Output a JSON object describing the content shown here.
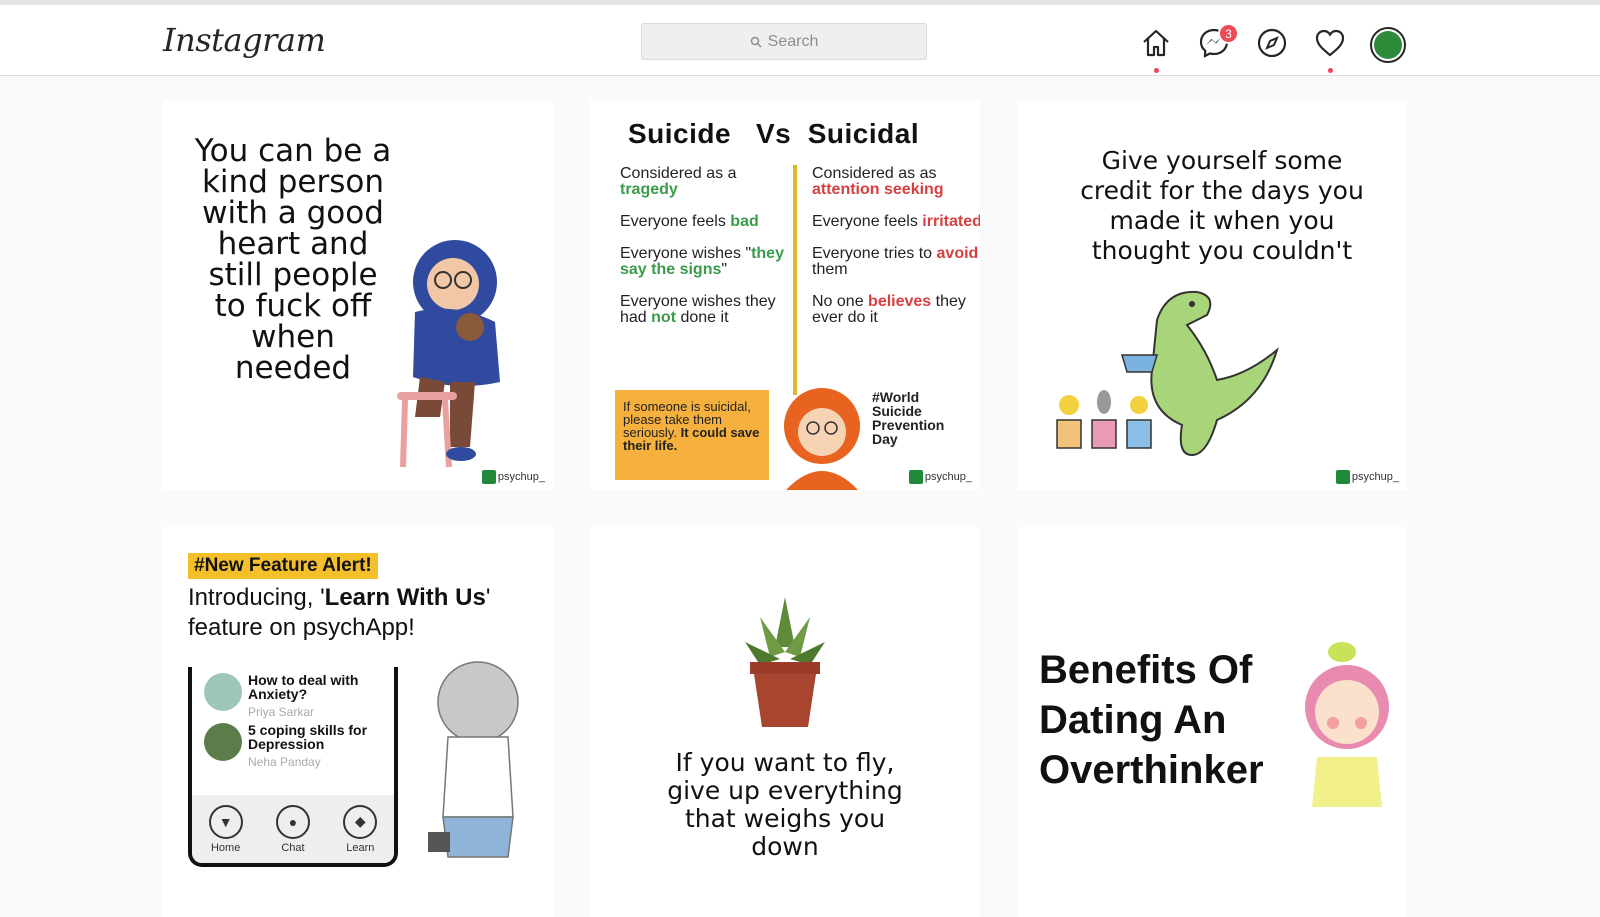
{
  "app": {
    "logo": "Instagram"
  },
  "search": {
    "placeholder": "Search"
  },
  "nav": {
    "messages_badge": "3"
  },
  "posts": [
    {
      "text": "You can be a kind person with a good heart and still people to fuck off when needed",
      "watermark": "psychup_"
    },
    {
      "heading_left": "Suicide",
      "heading_vs": "Vs",
      "heading_right": "Suicidal",
      "left": [
        {
          "pre": "Considered as a",
          "hl": "tragedy",
          "post": ""
        },
        {
          "pre": "Everyone feels",
          "hl": "bad",
          "post": ""
        },
        {
          "pre": "Everyone wishes \"",
          "hl": "they say the signs",
          "post": "\""
        },
        {
          "pre": "Everyone wishes they had",
          "hl": "not",
          "post": "done it"
        }
      ],
      "right": [
        {
          "pre": "Considered as as",
          "hl": "attention seeking",
          "post": ""
        },
        {
          "pre": "Everyone feels",
          "hl": "irritated",
          "post": ""
        },
        {
          "pre": "Everyone tries to",
          "hl": "avoid",
          "post": "them"
        },
        {
          "pre": "No one",
          "hl": "believes",
          "post": "they ever do it"
        }
      ],
      "box_text": "If someone is suicidal, please take them seriously.",
      "box_bold": "It could save their life.",
      "day_text": "#World Suicide Prevention Day",
      "watermark": "psychup_"
    },
    {
      "text": "Give yourself some credit for the days you made it when you thought you couldn't",
      "watermark": "psychup_"
    },
    {
      "tag": "#New Feature Alert!",
      "title_pre": "Introducing, '",
      "title_bold": "Learn With Us",
      "title_post": "' feature on psychApp!",
      "items": [
        {
          "title": "How to deal with Anxiety?",
          "author": "Priya Sarkar"
        },
        {
          "title": "5 coping skills for Depression",
          "author": "Neha Panday"
        }
      ],
      "tabs": [
        "Home",
        "Chat",
        "Learn"
      ]
    },
    {
      "text": "If you want to fly, give up everything that weighs you down"
    },
    {
      "title": "Benefits Of Dating An Overthinker"
    }
  ],
  "colors": {
    "badge": "#ed4956",
    "green": "#3a9b4a",
    "red": "#d64040",
    "yellow": "#f3c02b"
  }
}
